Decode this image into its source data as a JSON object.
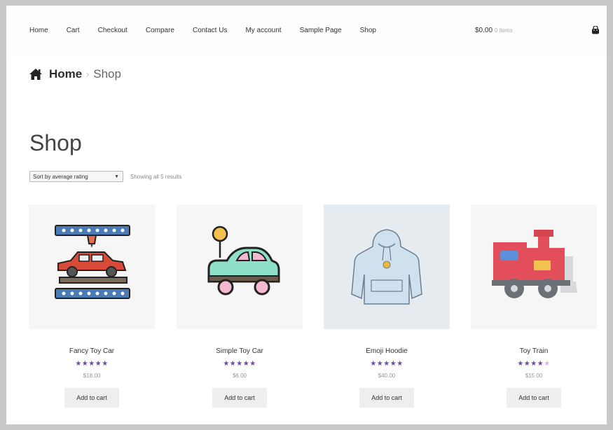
{
  "nav": {
    "items": [
      "Home",
      "Cart",
      "Checkout",
      "Compare",
      "Contact Us",
      "My account",
      "Sample Page",
      "Shop"
    ],
    "cart_total": "$0.00",
    "cart_items": "0 items"
  },
  "breadcrumb": {
    "home": "Home",
    "separator": "›",
    "current": "Shop"
  },
  "page": {
    "title": "Shop"
  },
  "sort": {
    "selected": "Sort by average rating"
  },
  "results": {
    "text": "Showing all 5 results"
  },
  "products": [
    {
      "name": "Fancy Toy Car",
      "stars": "★★★★★",
      "empty": "",
      "rating": 5,
      "price": "$18.00",
      "button": "Add to cart"
    },
    {
      "name": "Simple Toy Car",
      "stars": "★★★★★",
      "empty": "",
      "rating": 5,
      "price": "$6.00",
      "button": "Add to cart"
    },
    {
      "name": "Emoji Hoodie",
      "stars": "★★★★★",
      "empty": "",
      "rating": 5,
      "price": "$40.00",
      "button": "Add to cart"
    },
    {
      "name": "Toy Train",
      "stars": "★★★★",
      "empty": "★",
      "rating": 4,
      "price": "$15.00",
      "button": "Add to cart"
    }
  ]
}
